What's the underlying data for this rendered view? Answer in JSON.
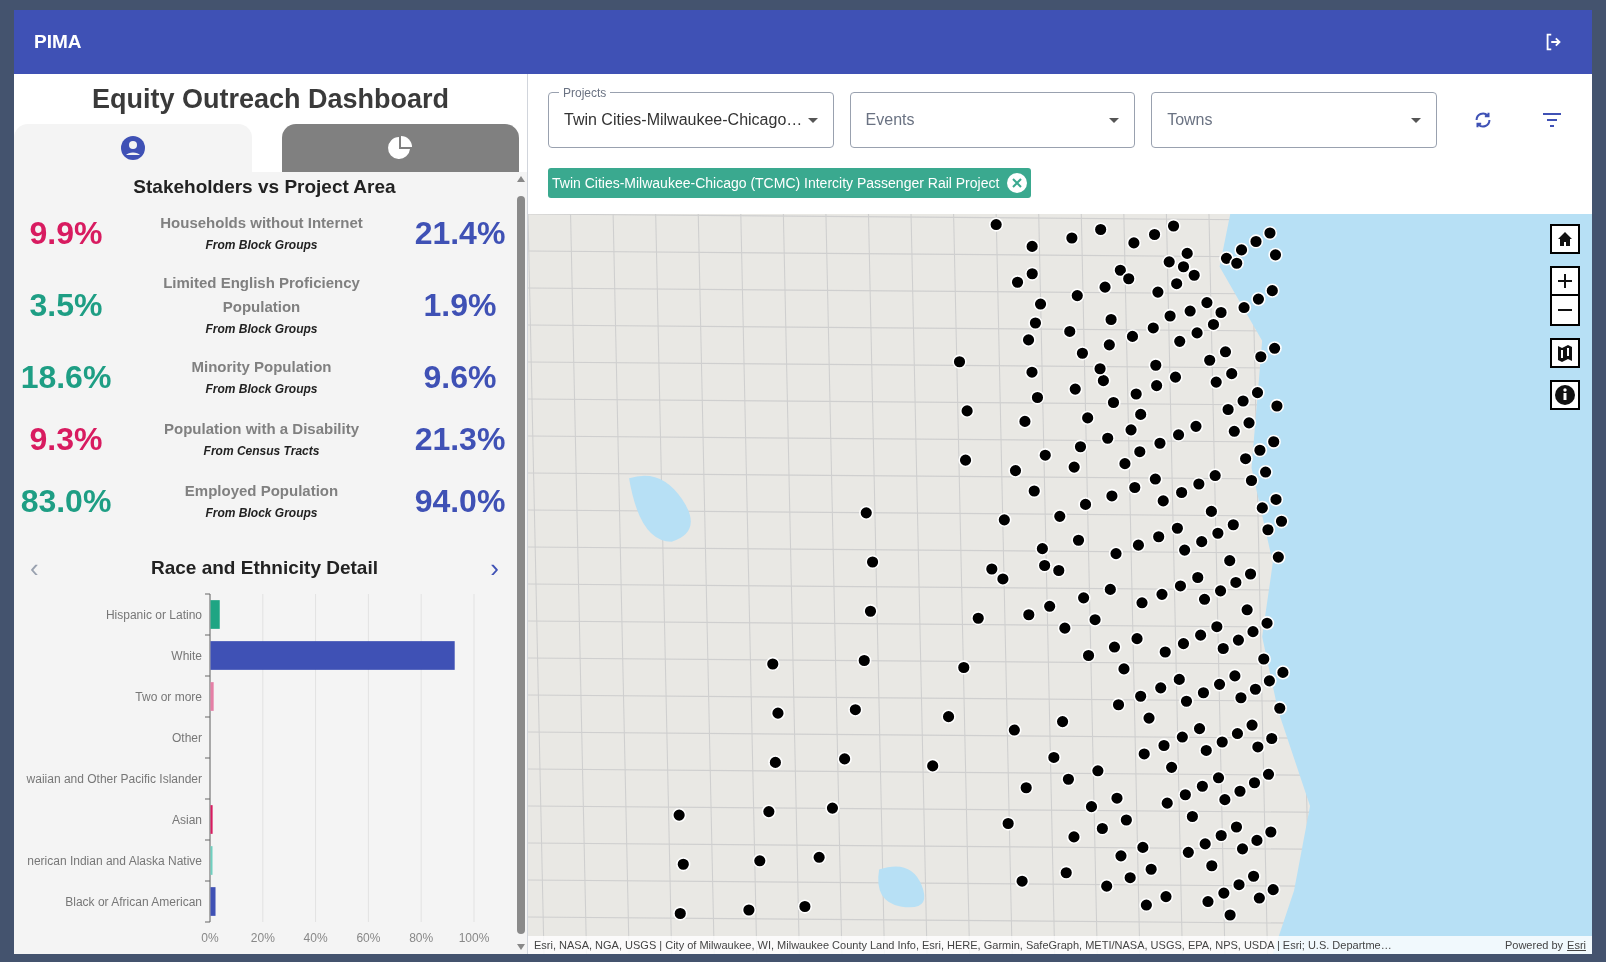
{
  "header": {
    "title": "PIMA"
  },
  "sidebar": {
    "title": "Equity Outreach Dashboard",
    "tabs": [
      {
        "kind": "person",
        "selected": true
      },
      {
        "kind": "pie",
        "selected": false
      }
    ],
    "section_title": "Stakeholders vs Project Area",
    "metrics": [
      {
        "stakeholders": "9.9%",
        "color": "#d81b60",
        "label": "Households without Internet",
        "source": "From Block Groups",
        "project_area": "21.4%"
      },
      {
        "stakeholders": "3.5%",
        "color": "#1e9e84",
        "label": "Limited English Proficiency Population",
        "source": "From Block Groups",
        "project_area": "1.9%"
      },
      {
        "stakeholders": "18.6%",
        "color": "#1e9e84",
        "label": "Minority Population",
        "source": "From Block Groups",
        "project_area": "9.6%"
      },
      {
        "stakeholders": "9.3%",
        "color": "#d81b60",
        "label": "Population with a Disability",
        "source": "From Census Tracts",
        "project_area": "21.3%"
      },
      {
        "stakeholders": "83.0%",
        "color": "#1e9e84",
        "label": "Employed Population",
        "source": "From Block Groups",
        "project_area": "94.0%"
      }
    ],
    "chart_title": "Race and Ethnicity Detail",
    "prev": "‹",
    "next": "›",
    "chart_data": {
      "type": "bar",
      "orientation": "horizontal",
      "categories": [
        "Hispanic or Latino",
        "White",
        "Two or more",
        "Other",
        "waiian and Other Pacific Islander",
        "Asian",
        "nerican Indian and Alaska Native",
        "Black or African American"
      ],
      "series": [
        {
          "values": [
            3.5,
            92.5,
            1.2,
            0,
            0,
            0.8,
            0.4,
            1.9
          ]
        }
      ],
      "grid": true,
      "colors": [
        "#1ea583",
        "#3f51b5",
        "#e57fa6",
        null,
        null,
        "#d81b60",
        "#6fd0c0",
        "#3f51b5"
      ],
      "xlim": [
        0,
        100
      ],
      "xticks": [
        {
          "value": 0,
          "label": "0%"
        },
        {
          "value": 20,
          "label": "20%"
        },
        {
          "value": 40,
          "label": "40%"
        },
        {
          "value": 60,
          "label": "60%"
        },
        {
          "value": 80,
          "label": "80%"
        },
        {
          "value": 100,
          "label": "100%"
        }
      ]
    }
  },
  "filters": {
    "projects": {
      "label": "Projects",
      "value": "Twin Cities-Milwaukee-Chicago…"
    },
    "events": {
      "placeholder": "Events"
    },
    "towns": {
      "placeholder": "Towns"
    },
    "chips": [
      "Twin Cities-Milwaukee-Chicago (TCMC) Intercity Passenger Rail Project"
    ]
  },
  "map": {
    "attribution": "Esri, NASA, NGA, USGS | City of Milwaukee, WI, Milwaukee County Land Info, Esri, HERE, Garmin, SafeGraph, METI/NASA, USGS, EPA, NPS, USDA | Esri; U.S. Departme…",
    "powered_by": "Powered by",
    "powered_link": "Esri"
  }
}
